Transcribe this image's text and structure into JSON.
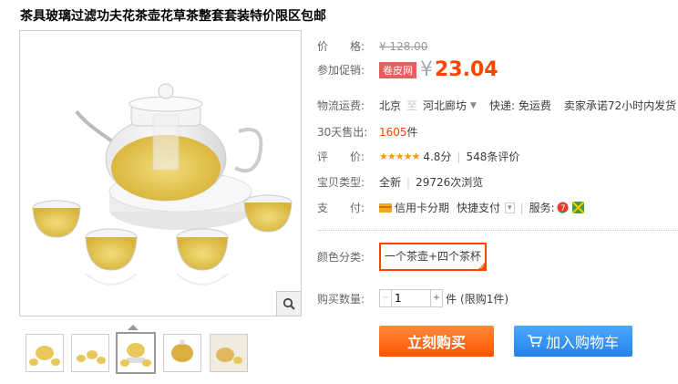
{
  "product": {
    "title": "茶具玻璃过滤功夫花茶壶花草茶整套套装特价限区包邮"
  },
  "price": {
    "label": "价　　格:",
    "original": "¥ 128.00",
    "promo_label": "参加促销:",
    "promo_badge": "卷皮网",
    "yen": "¥",
    "promo_price": "23.04"
  },
  "shipping": {
    "label": "物流运费:",
    "from": "北京",
    "sep": "至",
    "to": "河北廊坊",
    "fee": "快递: 免运费",
    "promise": "卖家承诺72小时内发货"
  },
  "sales": {
    "label": "30天售出:",
    "count": "1605",
    "unit": "件"
  },
  "rating": {
    "label": "评　　价:",
    "stars": "★★★★★",
    "score": "4.8分",
    "reviews": "548条评价"
  },
  "item_type": {
    "label": "宝贝类型:",
    "value": "全新",
    "views": "29726次浏览"
  },
  "payment": {
    "label": "支　　付:",
    "credit": "信用卡分期",
    "quick": "快捷支付",
    "service_label": "服务:"
  },
  "sku": {
    "label": "颜色分类:",
    "option": "一个茶壶+四个茶杯"
  },
  "quantity": {
    "label": "购买数量:",
    "value": "1",
    "unit": "件",
    "limit": "(限购1件)"
  },
  "actions": {
    "buy": "立刻购买",
    "cart": "加入购物车"
  },
  "colors": {
    "accent": "#ff4400",
    "buy": "#ff5400",
    "cart": "#2583e8"
  },
  "icons": {
    "zoom": "magnifier-icon",
    "cart": "cart-icon",
    "credit": "credit-card-icon"
  }
}
